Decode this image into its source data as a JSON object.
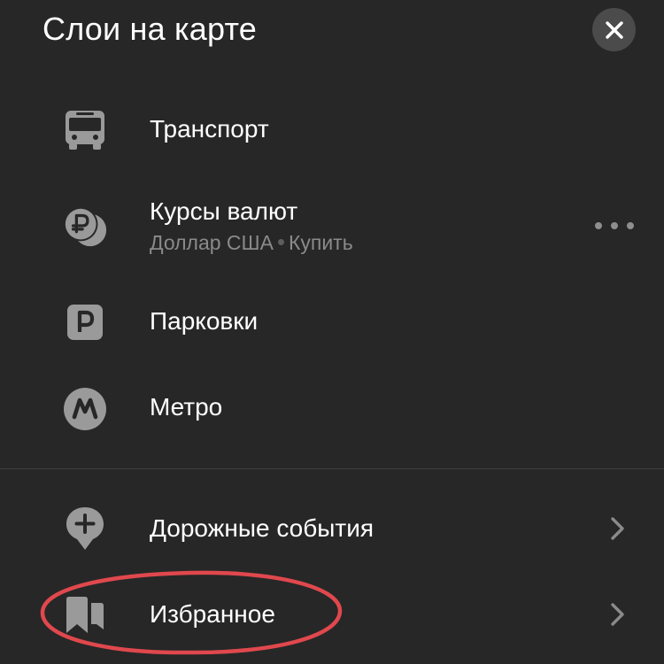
{
  "header": {
    "title": "Слои на карте",
    "close_icon": "close-icon"
  },
  "layers": [
    {
      "label": "Транспорт",
      "icon": "bus-icon"
    },
    {
      "label": "Курсы валют",
      "sub_currency": "Доллар США",
      "sub_action": "Купить",
      "icon": "currency-rub-icon",
      "more_icon": "more-dots-icon"
    },
    {
      "label": "Парковки",
      "icon": "parking-icon"
    },
    {
      "label": "Метро",
      "icon": "metro-icon"
    }
  ],
  "links": [
    {
      "label": "Дорожные события",
      "icon": "road-events-icon",
      "chevron": "chevron-right-icon"
    },
    {
      "label": "Избранное",
      "icon": "bookmark-icon",
      "chevron": "chevron-right-icon"
    }
  ],
  "colors": {
    "background": "#272727",
    "text": "#ffffff",
    "secondary_text": "#8a8a8a",
    "icon": "#9a9a9a",
    "close_button_bg": "#4b4b4b",
    "highlight": "#e0484d"
  }
}
